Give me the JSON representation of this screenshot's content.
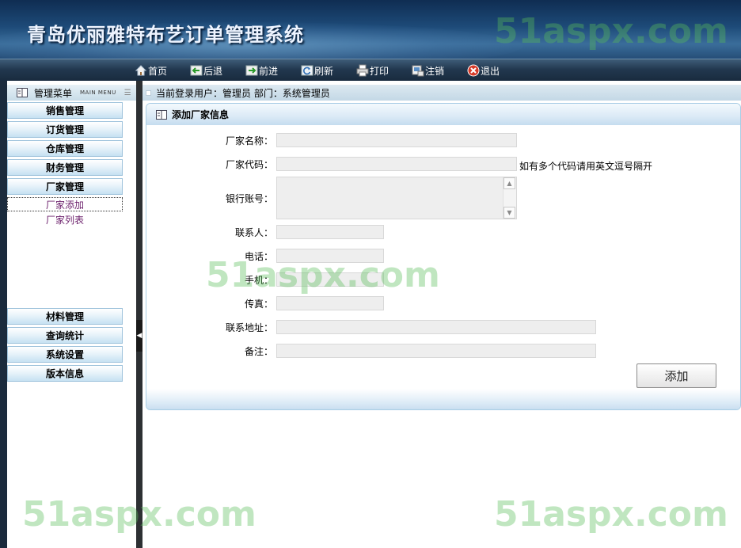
{
  "header": {
    "title": "青岛优丽雅特布艺订单管理系统",
    "watermark": "51aspx.com"
  },
  "toolbar": {
    "items": [
      {
        "label": "首页",
        "icon": "home-icon"
      },
      {
        "label": "后退",
        "icon": "back-arrow-icon"
      },
      {
        "label": "前进",
        "icon": "forward-arrow-icon"
      },
      {
        "label": "刷新",
        "icon": "refresh-icon"
      },
      {
        "label": "打印",
        "icon": "print-icon"
      },
      {
        "label": "注销",
        "icon": "logoff-icon"
      },
      {
        "label": "退出",
        "icon": "exit-icon"
      }
    ]
  },
  "sidebar": {
    "header_label": "管理菜单",
    "header_sub": "MAIN MENU",
    "menu_top": [
      {
        "label": "销售管理"
      },
      {
        "label": "订货管理"
      },
      {
        "label": "仓库管理"
      },
      {
        "label": "财务管理"
      },
      {
        "label": "厂家管理"
      }
    ],
    "sub_items": [
      {
        "label": "厂家添加",
        "active": true
      },
      {
        "label": "厂家列表",
        "active": false
      }
    ],
    "menu_bottom": [
      {
        "label": "材料管理"
      },
      {
        "label": "查询统计"
      },
      {
        "label": "系统设置"
      },
      {
        "label": "版本信息"
      }
    ]
  },
  "info_bar": {
    "text": "当前登录用户：管理员 部门：系统管理员"
  },
  "form": {
    "title": "添加厂家信息",
    "labels": {
      "name": "厂家名称：",
      "code": "厂家代码：",
      "bank": "银行账号：",
      "contact": "联系人：",
      "phone": "电话：",
      "mobile": "手机：",
      "fax": "传真：",
      "address": "联系地址：",
      "remark": "备注："
    },
    "values": {
      "name": "",
      "code": "",
      "bank": "",
      "contact": "",
      "phone": "",
      "mobile": "",
      "fax": "",
      "address": "",
      "remark": ""
    },
    "code_hint": "如有多个代码请用英文逗号隔开",
    "submit_label": "添加"
  },
  "colors": {
    "header_dark": "#0f2d52",
    "menu_border": "#9fc3dc",
    "sub_item_text": "#6b1f6b",
    "panel_border": "#a8cde5"
  }
}
